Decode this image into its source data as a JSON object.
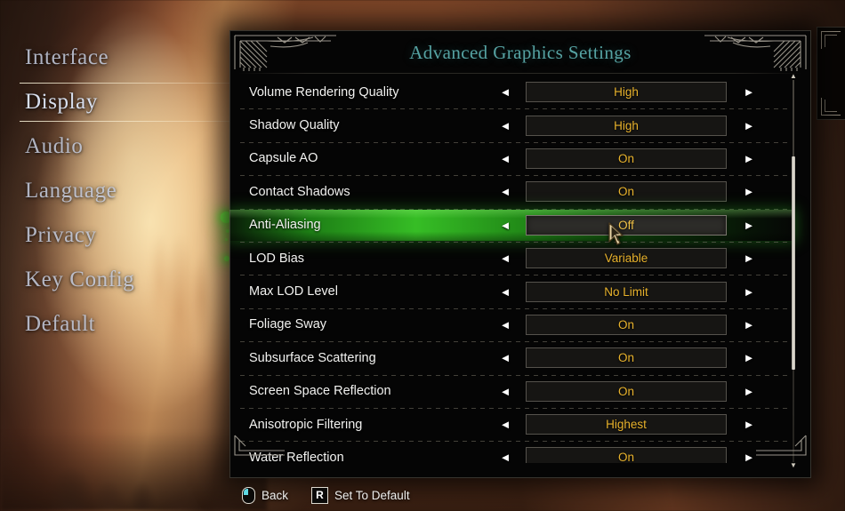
{
  "nav": {
    "items": [
      {
        "label": "Interface",
        "selected": false
      },
      {
        "label": "Display",
        "selected": true
      },
      {
        "label": "Audio",
        "selected": false
      },
      {
        "label": "Language",
        "selected": false
      },
      {
        "label": "Privacy",
        "selected": false
      },
      {
        "label": "Key Config",
        "selected": false
      },
      {
        "label": "Default",
        "selected": false
      }
    ]
  },
  "dialog": {
    "title": "Advanced Graphics Settings",
    "title_color": "#56a3a3",
    "value_color": "#e8b22c",
    "highlight_color": "#3acd28",
    "arrow_left": "◄",
    "arrow_right": "►",
    "rows": [
      {
        "label": "Volume Rendering Quality",
        "value": "High",
        "selected": false
      },
      {
        "label": "Shadow Quality",
        "value": "High",
        "selected": false
      },
      {
        "label": "Capsule AO",
        "value": "On",
        "selected": false
      },
      {
        "label": "Contact Shadows",
        "value": "On",
        "selected": false
      },
      {
        "label": "Anti-Aliasing",
        "value": "Off",
        "selected": true
      },
      {
        "label": "LOD Bias",
        "value": "Variable",
        "selected": false
      },
      {
        "label": "Max LOD Level",
        "value": "No Limit",
        "selected": false
      },
      {
        "label": "Foliage Sway",
        "value": "On",
        "selected": false
      },
      {
        "label": "Subsurface Scattering",
        "value": "On",
        "selected": false
      },
      {
        "label": "Screen Space Reflection",
        "value": "On",
        "selected": false
      },
      {
        "label": "Anisotropic Filtering",
        "value": "Highest",
        "selected": false
      },
      {
        "label": "Water Reflection",
        "value": "On",
        "selected": false
      }
    ]
  },
  "scrollbar": {
    "cap_top": "▲",
    "cap_bottom": "▼"
  },
  "bottombar": {
    "hints": [
      {
        "icon": "mouse-icon",
        "key": "",
        "label": "Back"
      },
      {
        "icon": "key-icon",
        "key": "R",
        "label": "Set To Default"
      }
    ]
  }
}
